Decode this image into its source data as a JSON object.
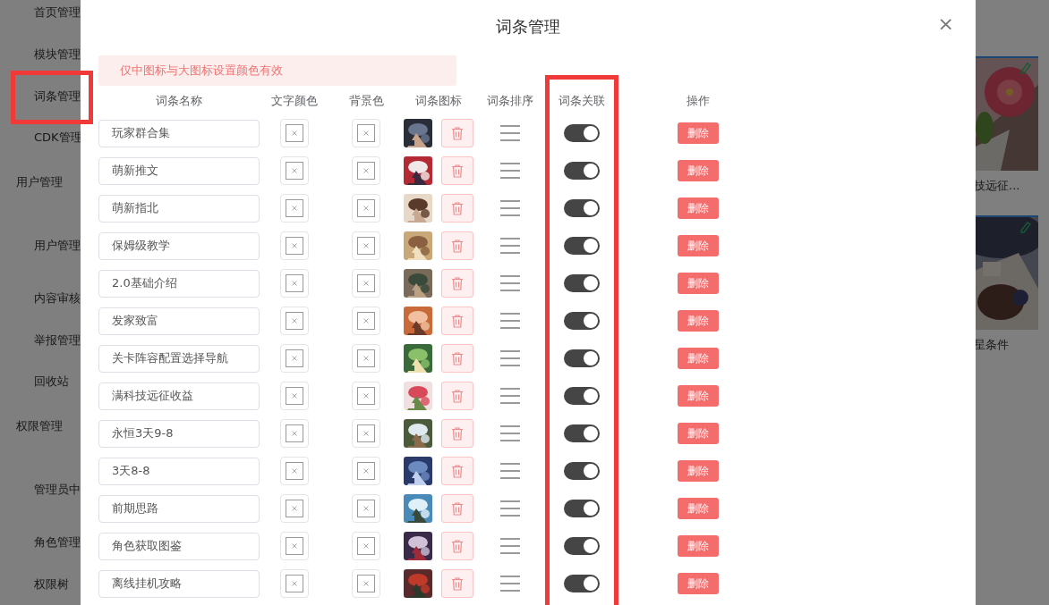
{
  "sidebar": {
    "items": [
      {
        "label": "首页管理",
        "kind": "item",
        "highlighted": false
      },
      {
        "label": "模块管理",
        "kind": "item",
        "highlighted": false
      },
      {
        "label": "词条管理",
        "kind": "item",
        "highlighted": true
      },
      {
        "label": "CDK管理",
        "kind": "item",
        "highlighted": false
      },
      {
        "label": "用户管理",
        "kind": "group",
        "highlighted": false
      },
      {
        "label": "用户管理",
        "kind": "item",
        "highlighted": false
      },
      {
        "label": "内容审核",
        "kind": "item",
        "highlighted": false
      },
      {
        "label": "举报管理",
        "kind": "item",
        "highlighted": false
      },
      {
        "label": "回收站",
        "kind": "item",
        "highlighted": false
      },
      {
        "label": "权限管理",
        "kind": "group",
        "highlighted": false
      },
      {
        "label": "管理员中",
        "kind": "item",
        "highlighted": false
      },
      {
        "label": "角色管理",
        "kind": "item",
        "highlighted": false
      },
      {
        "label": "权限树",
        "kind": "item",
        "highlighted": false
      }
    ]
  },
  "cards": [
    {
      "caption": "技远征..."
    },
    {
      "caption": "星条件"
    }
  ],
  "dialog": {
    "title": "词条管理",
    "close": "×",
    "notice": "仅中图标与大图标设置颜色有效",
    "columns": [
      {
        "label": "词条名称",
        "highlighted": false
      },
      {
        "label": "文字颜色",
        "highlighted": false
      },
      {
        "label": "背景色",
        "highlighted": false
      },
      {
        "label": "词条图标",
        "highlighted": false
      },
      {
        "label": "词条排序",
        "highlighted": false
      },
      {
        "label": "词条关联",
        "highlighted": true
      },
      {
        "label": "操作",
        "highlighted": false
      }
    ],
    "rows": [
      {
        "name": "玩家群合集",
        "linked": true,
        "action": "删除"
      },
      {
        "name": "萌新推文",
        "linked": true,
        "action": "删除"
      },
      {
        "name": "萌新指北",
        "linked": true,
        "action": "删除"
      },
      {
        "name": "保姆级教学",
        "linked": true,
        "action": "删除"
      },
      {
        "name": "2.0基础介绍",
        "linked": true,
        "action": "删除"
      },
      {
        "name": "发家致富",
        "linked": true,
        "action": "删除"
      },
      {
        "name": "关卡阵容配置选择导航",
        "linked": true,
        "action": "删除"
      },
      {
        "name": "满科技远征收益",
        "linked": true,
        "action": "删除"
      },
      {
        "name": "永恒3天9-8",
        "linked": true,
        "action": "删除"
      },
      {
        "name": "3天8-8",
        "linked": true,
        "action": "删除"
      },
      {
        "name": "前期思路",
        "linked": true,
        "action": "删除"
      },
      {
        "name": "角色获取图鉴",
        "linked": true,
        "action": "删除"
      },
      {
        "name": "离线挂机攻略",
        "linked": true,
        "action": "删除"
      }
    ]
  }
}
